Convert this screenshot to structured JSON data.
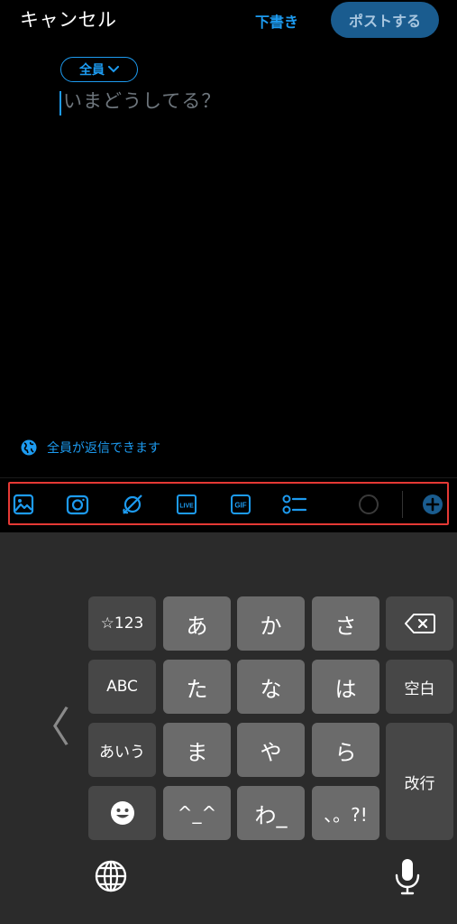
{
  "header": {
    "cancel_label": "キャンセル",
    "draft_label": "下書き",
    "post_label": "ポストする"
  },
  "compose": {
    "audience_label": "全員",
    "placeholder": "いまどうしてる？",
    "reply_setting_label": "全員が返信できます"
  },
  "toolbar": {
    "icons": [
      "image-icon",
      "camera-icon",
      "spaces-icon",
      "live-icon",
      "gif-icon",
      "poll-icon",
      "progress-ring-icon",
      "add-post-icon"
    ],
    "live_text": "LIVE",
    "gif_text": "GIF"
  },
  "keyboard": {
    "rows": [
      [
        "☆123",
        "あ",
        "か",
        "さ",
        "⌫"
      ],
      [
        "ABC",
        "た",
        "な",
        "は",
        "空白"
      ],
      [
        "あいう",
        "ま",
        "や",
        "ら",
        "改行"
      ],
      [
        "☻",
        "^_^",
        "わ_",
        "、。?!"
      ]
    ],
    "left_chevron": "〈",
    "icons": [
      "backspace-icon",
      "emoji-icon",
      "globe-icon",
      "microphone-icon"
    ]
  },
  "colors": {
    "accent": "#1d9bf0",
    "post_button": "#1a5c8f",
    "highlight_border": "#e53935",
    "keyboard_bg": "#2b2b2b",
    "key": "#6b6b6b",
    "key_function": "#474747"
  }
}
